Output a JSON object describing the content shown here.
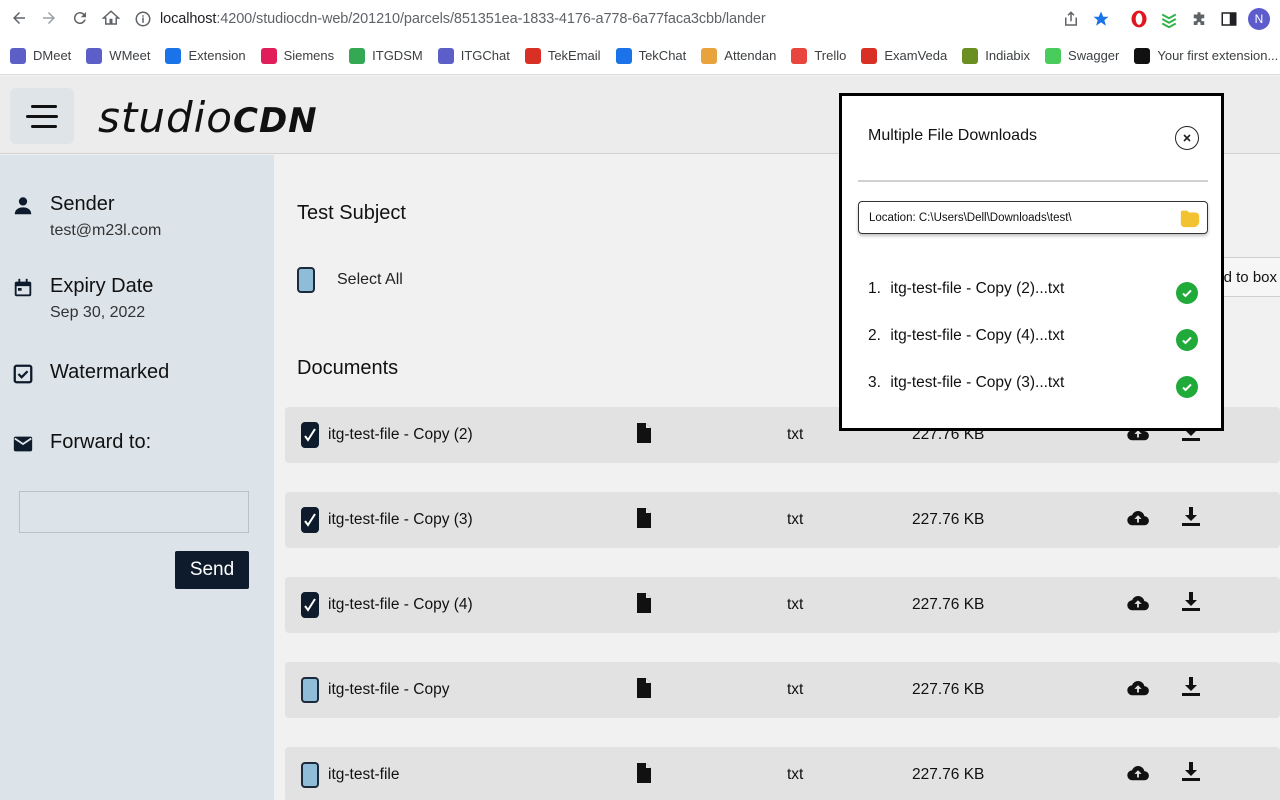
{
  "browser": {
    "url_host": "localhost",
    "url_rest": ":4200/studiocdn-web/201210/parcels/851351ea-1833-4176-a778-6a77faca3cbb/lander",
    "profile_initial": "N",
    "bookmarks": [
      {
        "label": "DMeet",
        "color": "#5b5fc7"
      },
      {
        "label": "WMeet",
        "color": "#5b5fc7"
      },
      {
        "label": "Extension",
        "color": "#1a73e8"
      },
      {
        "label": "Siemens",
        "color": "#e01e5a"
      },
      {
        "label": "ITGDSM",
        "color": "#34a853"
      },
      {
        "label": "ITGChat",
        "color": "#5b5fc7"
      },
      {
        "label": "TekEmail",
        "color": "#d93025"
      },
      {
        "label": "TekChat",
        "color": "#1a73e8"
      },
      {
        "label": "Attendan",
        "color": "#e8a33d"
      },
      {
        "label": "Trello",
        "color": "#e8453c"
      },
      {
        "label": "ExamVeda",
        "color": "#d93025"
      },
      {
        "label": "Indiabix",
        "color": "#6b8e23"
      },
      {
        "label": "Swagger",
        "color": "#49cc5c"
      },
      {
        "label": "Your first extension...",
        "color": "#111111"
      }
    ]
  },
  "app": {
    "logo_thin": "studio",
    "logo_bold": "CDN"
  },
  "sidebar": {
    "sender_label": "Sender",
    "sender_value": "test@m23l.com",
    "expiry_label": "Expiry Date",
    "expiry_value": "Sep 30, 2022",
    "watermarked_label": "Watermarked",
    "forward_label": "Forward to:",
    "forward_value": "",
    "send_label": "Send"
  },
  "main": {
    "subject": "Test Subject",
    "select_all_label": "Select All",
    "documents_title": "Documents",
    "add_to_box_label": "Add to box",
    "documents": [
      {
        "name": "itg-test-file - Copy (2)",
        "type": "txt",
        "size": "227.76 KB",
        "checked": true
      },
      {
        "name": "itg-test-file - Copy (3)",
        "type": "txt",
        "size": "227.76 KB",
        "checked": true
      },
      {
        "name": "itg-test-file - Copy (4)",
        "type": "txt",
        "size": "227.76 KB",
        "checked": true
      },
      {
        "name": "itg-test-file - Copy",
        "type": "txt",
        "size": "227.76 KB",
        "checked": false
      },
      {
        "name": "itg-test-file",
        "type": "txt",
        "size": "227.76 KB",
        "checked": false
      }
    ]
  },
  "modal": {
    "title": "Multiple File Downloads",
    "close_icon": "close-icon",
    "location_text": "Location: C:\\Users\\Dell\\Downloads\\test\\",
    "items": [
      {
        "num": "1.",
        "name": "itg-test-file - Copy (2)...txt",
        "status": "complete"
      },
      {
        "num": "2.",
        "name": "itg-test-file - Copy (4)...txt",
        "status": "complete"
      },
      {
        "num": "3.",
        "name": "itg-test-file - Copy (3)...txt",
        "status": "complete"
      }
    ]
  },
  "colors": {
    "primary_dark": "#0e1b2c",
    "success_green": "#1faa3a",
    "sidebar_bg": "#dce3e9",
    "folder_yellow": "#f2c230"
  }
}
